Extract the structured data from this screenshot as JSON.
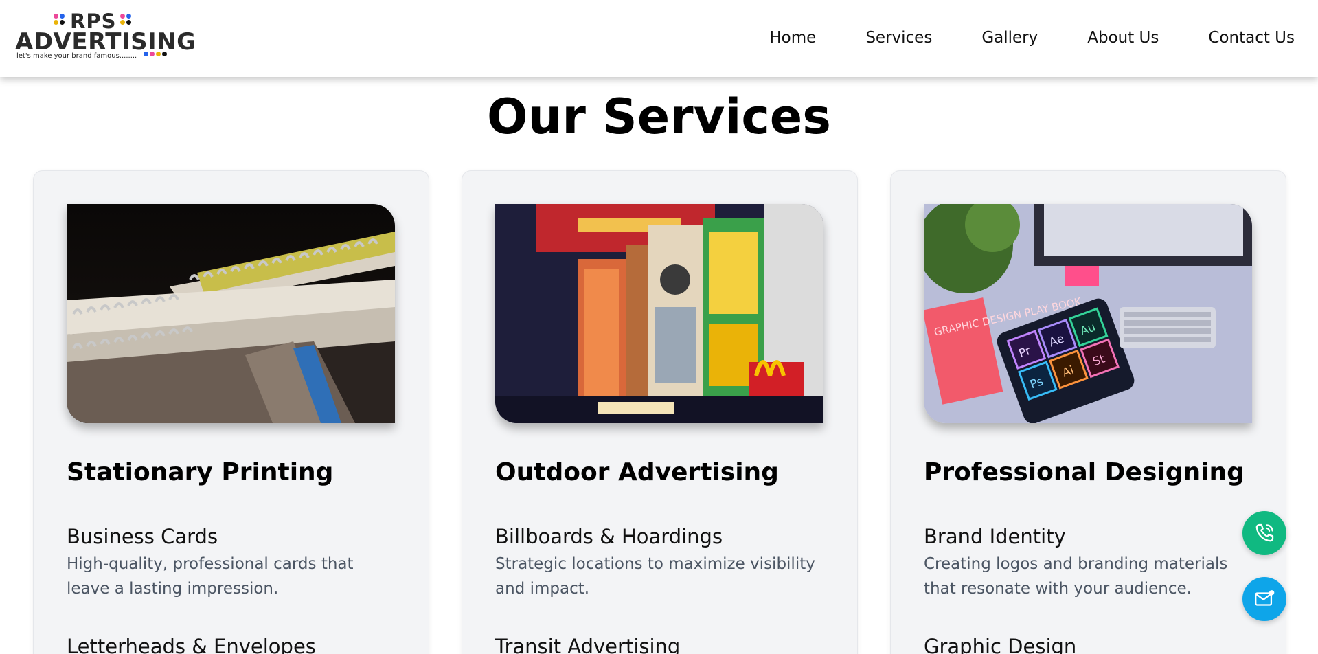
{
  "brand": {
    "name_top": "RPS",
    "name_main": "ADVERTISING",
    "tagline": "let's make your brand famous........"
  },
  "nav": {
    "items": [
      "Home",
      "Services",
      "Gallery",
      "About Us",
      "Contact Us"
    ]
  },
  "page": {
    "title": "Our Services"
  },
  "cards": [
    {
      "title": "Stationary Printing",
      "image_alt": "stacked spiral-bound notebooks",
      "items": [
        {
          "title": "Business Cards",
          "desc": "High-quality, professional cards that leave a lasting impression."
        },
        {
          "title": "Letterheads & Envelopes",
          "desc": ""
        }
      ]
    },
    {
      "title": "Outdoor Advertising",
      "image_alt": "illuminated billboards in a city square",
      "items": [
        {
          "title": "Billboards & Hoardings",
          "desc": "Strategic locations to maximize visibility and impact."
        },
        {
          "title": "Transit Advertising",
          "desc": ""
        }
      ]
    },
    {
      "title": "Professional Designing",
      "image_alt": "desk with design app icons tablet and keyboard",
      "items": [
        {
          "title": "Brand Identity",
          "desc": "Creating logos and branding materials that resonate with your audience."
        },
        {
          "title": "Graphic Design",
          "desc": ""
        }
      ]
    }
  ],
  "image3_tiles": [
    "Pr",
    "Ae",
    "Au",
    "Ps",
    "Ai",
    "St"
  ],
  "image3_book": "GRAPHIC DESIGN PLAY BOOK",
  "colors": {
    "accent_phone": "#10b981",
    "accent_mail": "#0ea5e9",
    "card_bg": "#f3f4f6",
    "desc_text": "#4b5563"
  },
  "floating": {
    "phone_icon": "phone-icon",
    "mail_icon": "mail-icon"
  }
}
